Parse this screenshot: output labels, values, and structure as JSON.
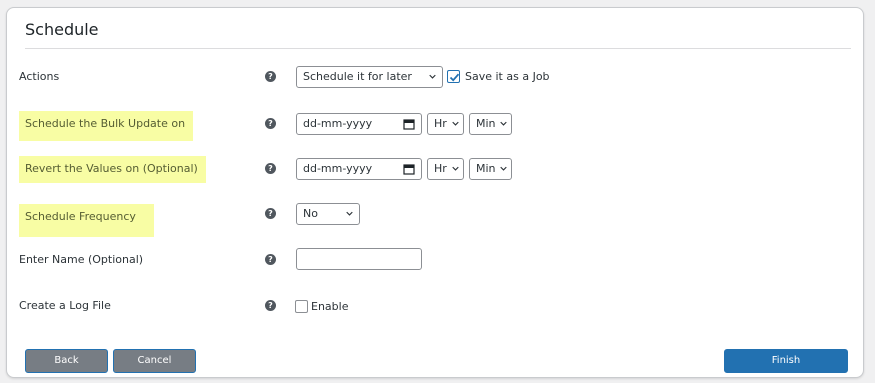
{
  "section": {
    "title": "Schedule"
  },
  "fields": {
    "actions": {
      "label": "Actions",
      "help": "?",
      "select_value": "Schedule it for later",
      "save_job_label": "Save it as a Job",
      "save_job_checked": true
    },
    "schedule_bulk": {
      "label": "Schedule the Bulk Update on",
      "help": "?",
      "date_placeholder": "dd-mm-yyyy",
      "hour": "Hr",
      "minute": "Min"
    },
    "revert_values": {
      "label": "Revert the Values on (Optional)",
      "help": "?",
      "date_placeholder": "dd-mm-yyyy",
      "hour": "Hr",
      "minute": "Min"
    },
    "frequency": {
      "label": "Schedule Frequency",
      "help": "?",
      "select_value": "No"
    },
    "name": {
      "label": "Enter Name (Optional)",
      "help": "?",
      "value": ""
    },
    "log_file": {
      "label": "Create a Log File",
      "help": "?",
      "checkbox_label": "Enable",
      "checked": false
    }
  },
  "buttons": {
    "back": "Back",
    "cancel": "Cancel",
    "finish": "Finish"
  },
  "colors": {
    "highlight": "#f8fda4",
    "primary": "#2271b1",
    "secondary_button": "#777d84"
  }
}
